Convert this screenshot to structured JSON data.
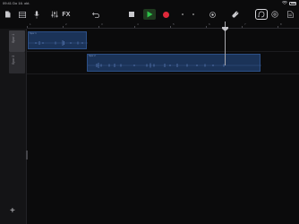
{
  "statusbar": {
    "time": "09:41",
    "date": "Do 16. okt."
  },
  "toolbar": {
    "fx_label": "FX",
    "accent_play": "#2fc24a",
    "accent_record": "#e0293a"
  },
  "ruler": {
    "marks": [
      "1",
      "2",
      "3",
      "4",
      "5",
      "6",
      "7",
      "8",
      "9",
      "10",
      "11",
      "12"
    ]
  },
  "tracks": [
    {
      "label": "Spor 1"
    },
    {
      "label": "Spor 2"
    }
  ],
  "regions": [
    {
      "name": "Spor 1"
    },
    {
      "name": "Spor 2"
    }
  ],
  "sidebar": {
    "add_label": "+"
  }
}
